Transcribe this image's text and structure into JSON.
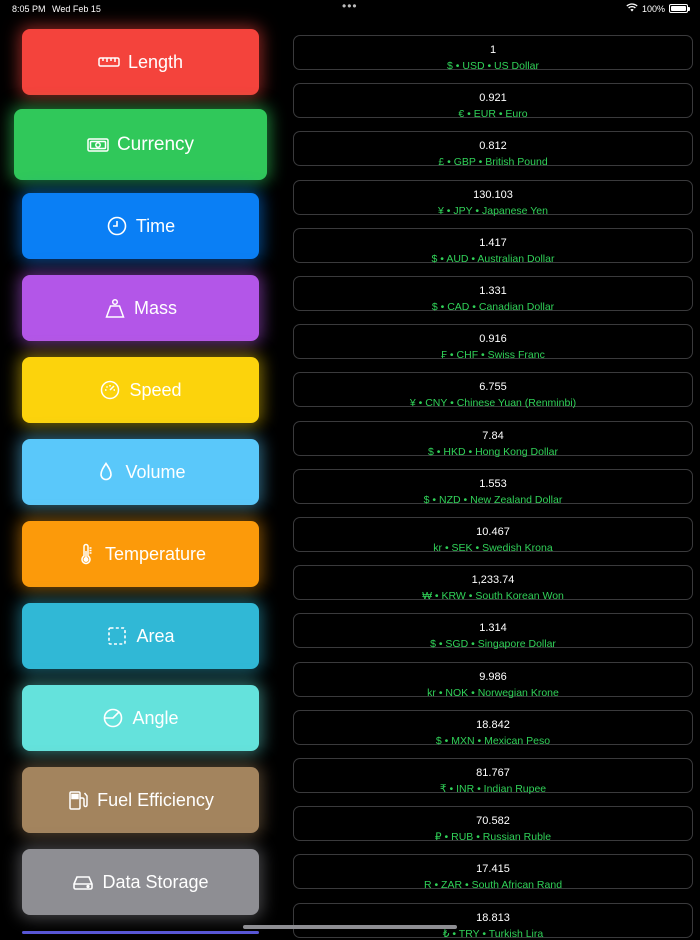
{
  "status_bar": {
    "time": "8:05 PM",
    "date": "Wed Feb 15",
    "dots": "•••",
    "battery": "100%"
  },
  "categories": [
    {
      "label": "Length",
      "color": "#f4433c",
      "glow": "rgba(244,67,60,0.55)"
    },
    {
      "label": "Currency",
      "color": "#30c85a",
      "glow": "rgba(48,200,90,0.6)"
    },
    {
      "label": "Time",
      "color": "#0a7ff5",
      "glow": "rgba(10,127,245,0.55)"
    },
    {
      "label": "Mass",
      "color": "#b356e8",
      "glow": "rgba(179,86,232,0.55)"
    },
    {
      "label": "Speed",
      "color": "#fcd30c",
      "glow": "rgba(252,211,12,0.5)"
    },
    {
      "label": "Volume",
      "color": "#5ac8fa",
      "glow": "rgba(90,200,250,0.5)"
    },
    {
      "label": "Temperature",
      "color": "#fc9a0a",
      "glow": "rgba(252,154,10,0.5)"
    },
    {
      "label": "Area",
      "color": "#30b8d6",
      "glow": "rgba(48,184,214,0.5)"
    },
    {
      "label": "Angle",
      "color": "#64e2dc",
      "glow": "rgba(100,226,220,0.5)"
    },
    {
      "label": "Fuel Efficiency",
      "color": "#a3845e",
      "glow": "rgba(163,132,94,0.5)"
    },
    {
      "label": "Data Storage",
      "color": "#8e8e93",
      "glow": "rgba(142,142,147,0.5)"
    }
  ],
  "rates": [
    {
      "value": "1",
      "symbol": "$",
      "code": "USD",
      "name": "US Dollar"
    },
    {
      "value": "0.921",
      "symbol": "€",
      "code": "EUR",
      "name": "Euro"
    },
    {
      "value": "0.812",
      "symbol": "£",
      "code": "GBP",
      "name": "British Pound"
    },
    {
      "value": "130.103",
      "symbol": "¥",
      "code": "JPY",
      "name": "Japanese Yen"
    },
    {
      "value": "1.417",
      "symbol": "$",
      "code": "AUD",
      "name": "Australian Dollar"
    },
    {
      "value": "1.331",
      "symbol": "$",
      "code": "CAD",
      "name": "Canadian Dollar"
    },
    {
      "value": "0.916",
      "symbol": "₣",
      "code": "CHF",
      "name": "Swiss Franc"
    },
    {
      "value": "6.755",
      "symbol": "¥",
      "code": "CNY",
      "name": "Chinese Yuan (Renminbi)"
    },
    {
      "value": "7.84",
      "symbol": "$",
      "code": "HKD",
      "name": "Hong Kong Dollar"
    },
    {
      "value": "1.553",
      "symbol": "$",
      "code": "NZD",
      "name": "New Zealand Dollar"
    },
    {
      "value": "10.467",
      "symbol": "kr",
      "code": "SEK",
      "name": "Swedish Krona"
    },
    {
      "value": "1,233.74",
      "symbol": "₩",
      "code": "KRW",
      "name": "South Korean Won"
    },
    {
      "value": "1.314",
      "symbol": "$",
      "code": "SGD",
      "name": "Singapore Dollar"
    },
    {
      "value": "9.986",
      "symbol": "kr",
      "code": "NOK",
      "name": "Norwegian Krone"
    },
    {
      "value": "18.842",
      "symbol": "$",
      "code": "MXN",
      "name": "Mexican Peso"
    },
    {
      "value": "81.767",
      "symbol": "₹",
      "code": "INR",
      "name": "Indian Rupee"
    },
    {
      "value": "70.582",
      "symbol": "₽",
      "code": "RUB",
      "name": "Russian Ruble"
    },
    {
      "value": "17.415",
      "symbol": "R",
      "code": "ZAR",
      "name": "South African Rand"
    },
    {
      "value": "18.813",
      "symbol": "₺",
      "code": "TRY",
      "name": "Turkish Lira"
    }
  ]
}
